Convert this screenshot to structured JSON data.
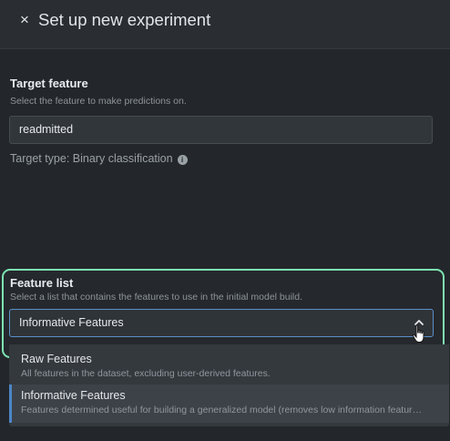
{
  "header": {
    "close_symbol": "×",
    "title": "Set up new experiment"
  },
  "target": {
    "label": "Target feature",
    "help": "Select the feature to make predictions on.",
    "value": "readmitted",
    "type_text": "Target type: Binary classification",
    "info_symbol": "i"
  },
  "feature_list": {
    "label": "Feature list",
    "help": "Select a list that contains the features to use in the initial model build.",
    "selected": "Informative Features",
    "highlight_color": "#7de4b2",
    "options": [
      {
        "title": "Raw Features",
        "description": "All features in the dataset, excluding user-derived features."
      },
      {
        "title": "Informative Features",
        "description": "Features determined useful for building a generalized model (removes low information features)"
      }
    ]
  },
  "icons": {
    "close": "close-icon",
    "info": "info-icon",
    "chevron": "chevron-up-icon",
    "cursor": "hand-pointer-icon"
  }
}
